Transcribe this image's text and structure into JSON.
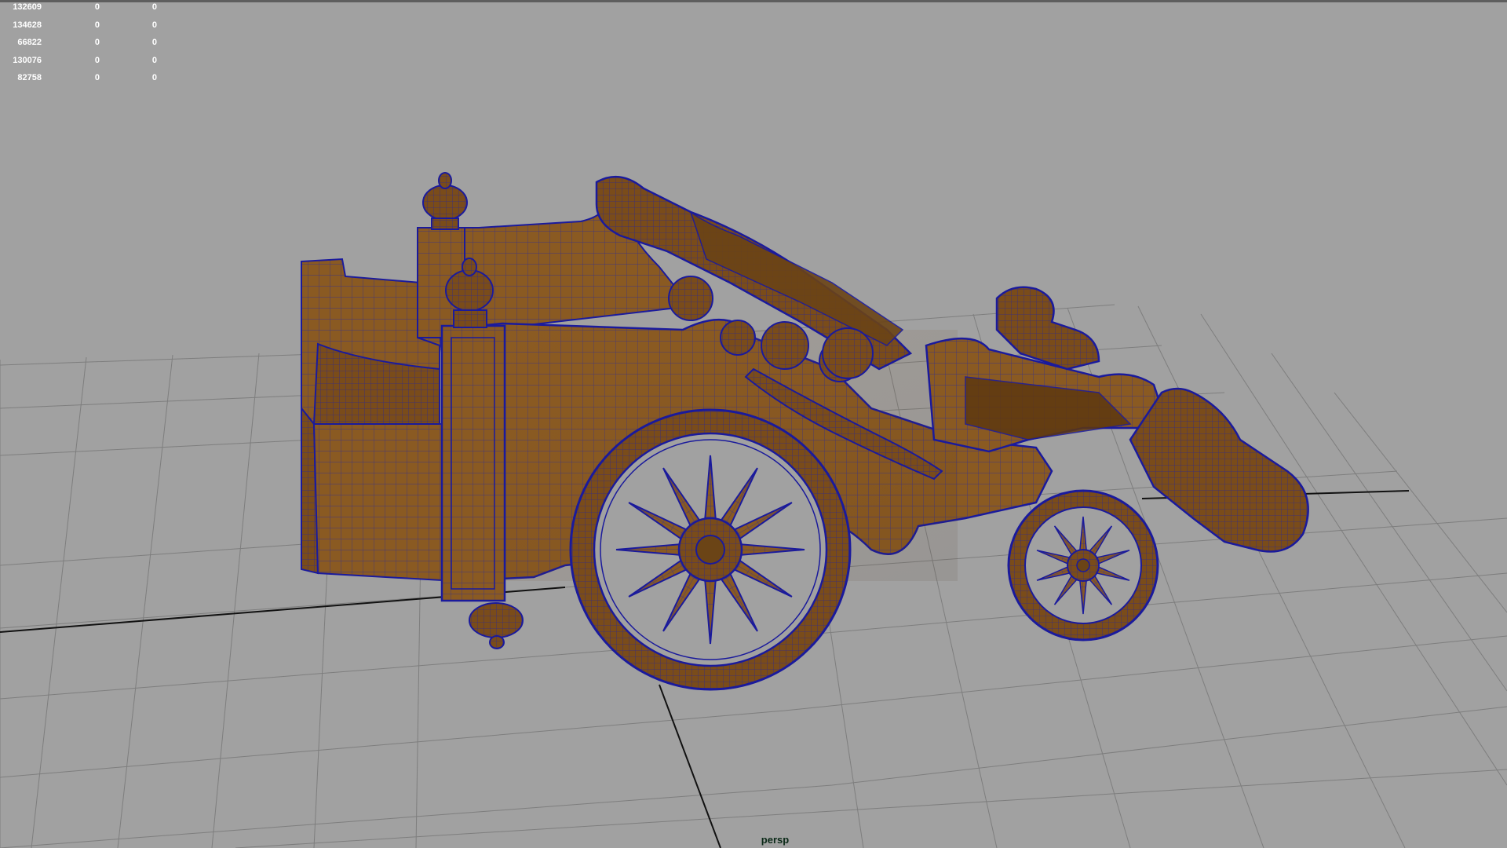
{
  "viewport": {
    "camera": "persp",
    "background_color": "#a1a1a1",
    "grid_color": "#7a7a7a",
    "axis_color": "#111111"
  },
  "hud": {
    "rows": [
      [
        "132609",
        "0",
        "0"
      ],
      [
        "134628",
        "0",
        "0"
      ],
      [
        "66822",
        "0",
        "0"
      ],
      [
        "130076",
        "0",
        "0"
      ],
      [
        "82758",
        "0",
        "0"
      ]
    ]
  },
  "model": {
    "wood_color": "#8a5a22",
    "wood_dark": "#5e3810",
    "wire_color": "#1a1a9c"
  }
}
